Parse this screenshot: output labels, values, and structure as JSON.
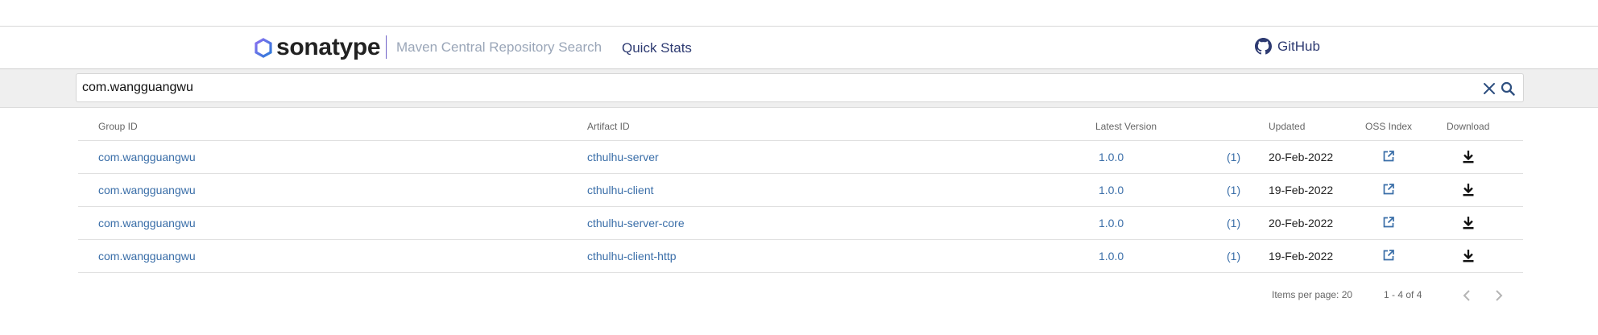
{
  "header": {
    "brand": "sonatype",
    "site_title": "Maven Central Repository Search",
    "nav_quick_stats": "Quick Stats",
    "github_label": "GitHub"
  },
  "search": {
    "value": "com.wangguangwu",
    "placeholder": ""
  },
  "table": {
    "columns": [
      "Group ID",
      "Artifact ID",
      "Latest Version",
      "Updated",
      "OSS Index",
      "Download"
    ],
    "rows": [
      {
        "group_id": "com.wangguangwu",
        "artifact_id": "cthulhu-server",
        "version": "1.0.0",
        "count": "(1)",
        "updated": "20-Feb-2022"
      },
      {
        "group_id": "com.wangguangwu",
        "artifact_id": "cthulhu-client",
        "version": "1.0.0",
        "count": "(1)",
        "updated": "19-Feb-2022"
      },
      {
        "group_id": "com.wangguangwu",
        "artifact_id": "cthulhu-server-core",
        "version": "1.0.0",
        "count": "(1)",
        "updated": "20-Feb-2022"
      },
      {
        "group_id": "com.wangguangwu",
        "artifact_id": "cthulhu-client-http",
        "version": "1.0.0",
        "count": "(1)",
        "updated": "19-Feb-2022"
      }
    ]
  },
  "pagination": {
    "items_per_page": "Items per page: 20",
    "range": "1 - 4 of 4"
  },
  "icons": {
    "logo": "sonatype-hexagon-icon",
    "github": "github-icon",
    "clear": "close-icon",
    "search": "search-icon",
    "oss_index": "external-link-icon",
    "download": "download-icon",
    "prev": "chevron-left-icon",
    "next": "chevron-right-icon"
  },
  "colors": {
    "link": "#3a6ea8",
    "nav": "#2e3b72",
    "brand_accent": "#6f62c8"
  }
}
